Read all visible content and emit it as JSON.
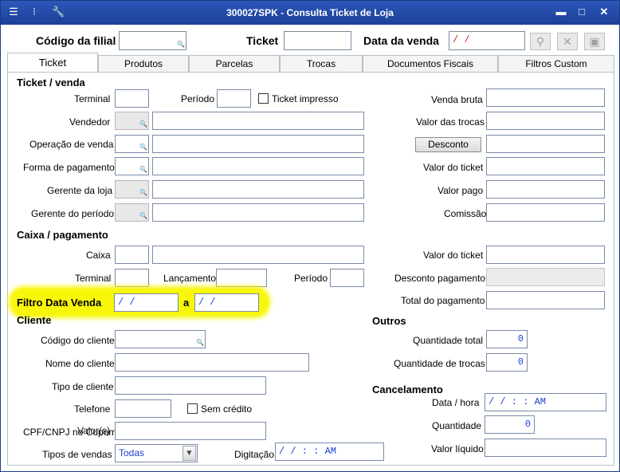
{
  "window": {
    "title": "300027SPK - Consulta Ticket de Loja",
    "colors": {
      "titlebar": "#1d3f98",
      "highlight": "#f8f60a",
      "value_text": "#1a3fd0"
    }
  },
  "header": {
    "filial_label": "Código da filial",
    "ticket_label": "Ticket",
    "data_venda_label": "Data da venda",
    "data_venda_value": " / /"
  },
  "tabs": [
    {
      "label": "Ticket"
    },
    {
      "label": "Produtos"
    },
    {
      "label": "Parcelas"
    },
    {
      "label": "Trocas"
    },
    {
      "label": "Documentos Fiscais"
    },
    {
      "label": "Filtros Custom"
    }
  ],
  "ticket_venda": {
    "heading": "Ticket / venda",
    "terminal": "Terminal",
    "periodo": "Período",
    "ticket_impresso": "Ticket impresso",
    "vendedor": "Vendedor",
    "operacao": "Operação de venda",
    "forma_pagamento": "Forma de pagamento",
    "gerente_loja": "Gerente da loja",
    "gerente_periodo": "Gerente do período",
    "venda_bruta": "Venda bruta",
    "valor_trocas": "Valor das trocas",
    "desconto_button": "Desconto",
    "valor_ticket": "Valor do ticket",
    "valor_pago": "Valor pago",
    "comissao": "Comissão"
  },
  "caixa_pagamento": {
    "heading": "Caixa / pagamento",
    "caixa": "Caixa",
    "terminal": "Terminal",
    "lancamento": "Lançamento",
    "periodo": "Período",
    "valor_ticket": "Valor do ticket",
    "desconto_pagamento": "Desconto pagamento",
    "total_pagamento": "Total do pagamento"
  },
  "filtro": {
    "label": "Filtro Data Venda",
    "from_value": " / /",
    "a_label": "a",
    "to_value": " / /"
  },
  "cliente": {
    "heading": "Cliente",
    "codigo": "Código do cliente",
    "nome": "Nome do cliente",
    "tipo": "Tipo de cliente",
    "telefone": "Telefone",
    "sem_credito": "Sem crédito",
    "cpf_label": "CPF/CNPJ no Cupom",
    "valor_overlap": "Valor(s)",
    "tipos_vendas": "Tipos de vendas",
    "tipos_vendas_value": "Todas",
    "digitacao": "Digitação",
    "digitacao_value": " / /    : : AM"
  },
  "outros": {
    "heading": "Outros",
    "quantidade_total": "Quantidade total",
    "quantidade_total_value": "0",
    "quantidade_trocas": "Quantidade de trocas",
    "quantidade_trocas_value": "0"
  },
  "cancelamento": {
    "heading": "Cancelamento",
    "data_hora": "Data / hora",
    "data_hora_value": " / /    : : AM",
    "quantidade": "Quantidade",
    "quantidade_value": "0",
    "valor_liquido": "Valor líquido"
  }
}
